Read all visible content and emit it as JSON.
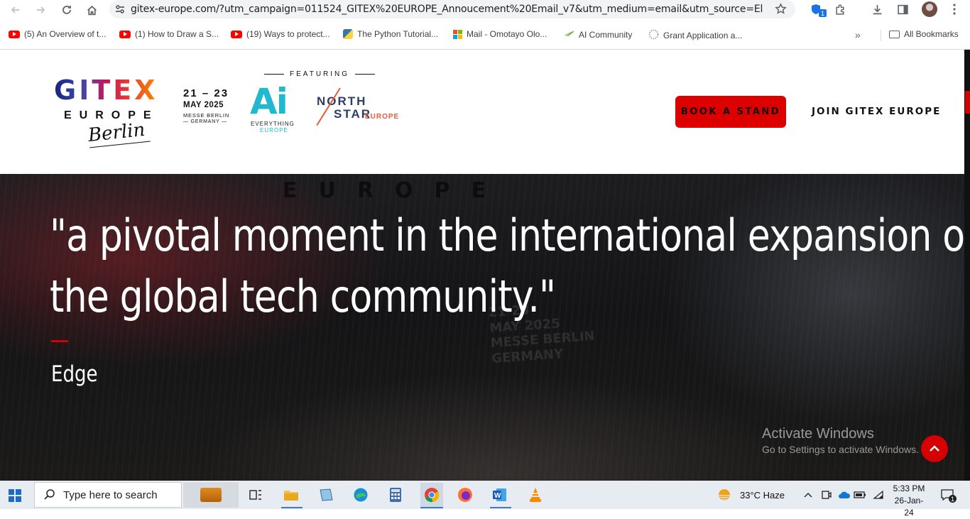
{
  "browser": {
    "url": "gitex-europe.com/?utm_campaign=011524_GITEX%20EUROPE_Annoucement%20Email_v7&utm_medium=email&utm_source=Eloqua&elqTra...",
    "extension_badge": "1",
    "bookmarks": [
      {
        "label": "(5) An Overview of t...",
        "icon": "youtube-icon"
      },
      {
        "label": "(1) How to Draw a S...",
        "icon": "youtube-icon"
      },
      {
        "label": "(19) Ways to protect...",
        "icon": "youtube-icon"
      },
      {
        "label": "The Python Tutorial...",
        "icon": "python-icon"
      },
      {
        "label": "Mail - Omotayo Olo...",
        "icon": "microsoft-icon"
      },
      {
        "label": "AI Community",
        "icon": "ai-community-icon"
      },
      {
        "label": "Grant Application a...",
        "icon": "grant-icon"
      }
    ],
    "more_label": "»",
    "all_bookmarks": "All Bookmarks"
  },
  "site": {
    "logo": {
      "gitex": "GITEX",
      "europe": "EUROPE",
      "berlin": "Berlin",
      "dates": "21 – 23",
      "month": "MAY 2025",
      "venue": "MESSE BERLIN",
      "country": "— GERMANY —"
    },
    "featuring": "FEATURING",
    "ai_logo": {
      "mark": "Ai",
      "line1": "EVERYTHING",
      "line2": "EUROPE"
    },
    "northstar_logo": {
      "line1": "NORTH",
      "line2": "STAR",
      "sub": "EUROPE"
    },
    "book_button": "BOOK A STAND",
    "join_link": "JOIN GITEX EUROPE"
  },
  "hero": {
    "ghost_text": "EUROPE",
    "ghost_sign": "21-23\nMAY 2025\nMESSE BERLIN\nGERMANY",
    "quote_line1": "\"a pivotal moment in the international expansion of",
    "quote_line2": "the global tech community.\"",
    "author": "Edge",
    "accent": "#d50000"
  },
  "windows_watermark": {
    "title": "Activate Windows",
    "subtitle": "Go to Settings to activate Windows."
  },
  "taskbar": {
    "search_placeholder": "Type here to search",
    "weather": "33°C  Haze",
    "time": "5:33 PM",
    "date": "26-Jan-24",
    "notification_count": "1"
  }
}
